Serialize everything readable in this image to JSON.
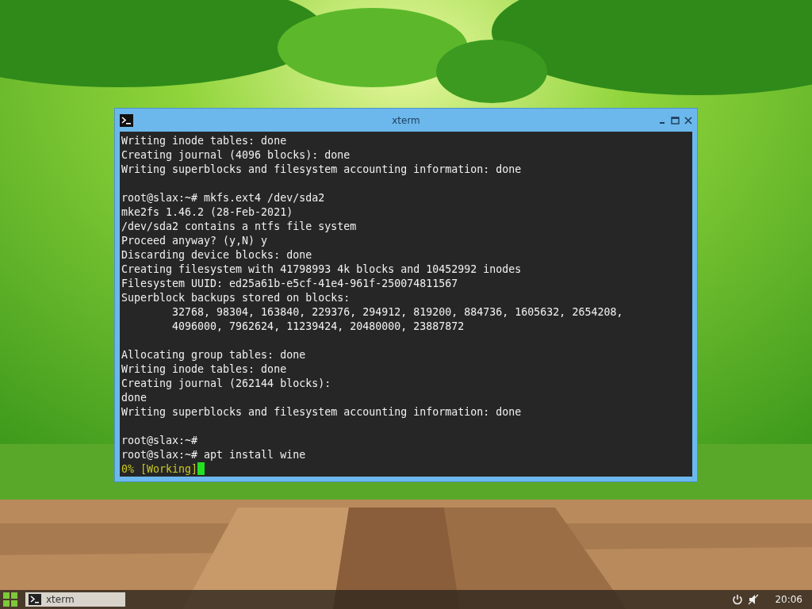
{
  "window": {
    "title": "xterm",
    "lines": [
      {
        "kind": "output",
        "text": "Writing inode tables: done"
      },
      {
        "kind": "output",
        "text": "Creating journal (4096 blocks): done"
      },
      {
        "kind": "output",
        "text": "Writing superblocks and filesystem accounting information: done"
      },
      {
        "kind": "blank"
      },
      {
        "kind": "output",
        "text": "root@slax:~# mkfs.ext4 /dev/sda2"
      },
      {
        "kind": "output",
        "text": "mke2fs 1.46.2 (28-Feb-2021)"
      },
      {
        "kind": "output",
        "text": "/dev/sda2 contains a ntfs file system"
      },
      {
        "kind": "output",
        "text": "Proceed anyway? (y,N) y"
      },
      {
        "kind": "output",
        "text": "Discarding device blocks: done"
      },
      {
        "kind": "output",
        "text": "Creating filesystem with 41798993 4k blocks and 10452992 inodes"
      },
      {
        "kind": "output",
        "text": "Filesystem UUID: ed25a61b-e5cf-41e4-961f-250074811567"
      },
      {
        "kind": "output",
        "text": "Superblock backups stored on blocks:"
      },
      {
        "kind": "output",
        "text": "        32768, 98304, 163840, 229376, 294912, 819200, 884736, 1605632, 2654208,"
      },
      {
        "kind": "output",
        "text": "        4096000, 7962624, 11239424, 20480000, 23887872"
      },
      {
        "kind": "blank"
      },
      {
        "kind": "output",
        "text": "Allocating group tables: done"
      },
      {
        "kind": "output",
        "text": "Writing inode tables: done"
      },
      {
        "kind": "output",
        "text": "Creating journal (262144 blocks):"
      },
      {
        "kind": "output",
        "text": "done"
      },
      {
        "kind": "output",
        "text": "Writing superblocks and filesystem accounting information: done"
      },
      {
        "kind": "blank"
      },
      {
        "kind": "output",
        "text": "root@slax:~#"
      },
      {
        "kind": "output",
        "text": "root@slax:~# apt install wine"
      },
      {
        "kind": "progress",
        "text": "0% [Working]",
        "cursor": true
      }
    ]
  },
  "taskbar": {
    "tasks": [
      {
        "label": "xterm",
        "selected": true
      }
    ],
    "clock": "20:06"
  }
}
